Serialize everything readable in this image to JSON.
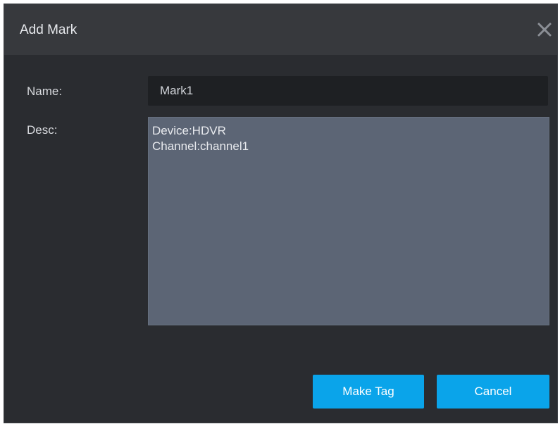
{
  "dialog": {
    "title": "Add Mark",
    "close_icon": "close-icon"
  },
  "form": {
    "name_label": "Name:",
    "name_value": "Mark1",
    "desc_label": "Desc:",
    "desc_value": "Device:HDVR\nChannel:channel1"
  },
  "buttons": {
    "make_tag_label": "Make Tag",
    "cancel_label": "Cancel"
  },
  "colors": {
    "accent": "#0aa4ea",
    "background": "#2a2c30",
    "titlebar": "#37393d",
    "input_bg": "#1e2023",
    "textarea_bg": "#5c6575"
  }
}
